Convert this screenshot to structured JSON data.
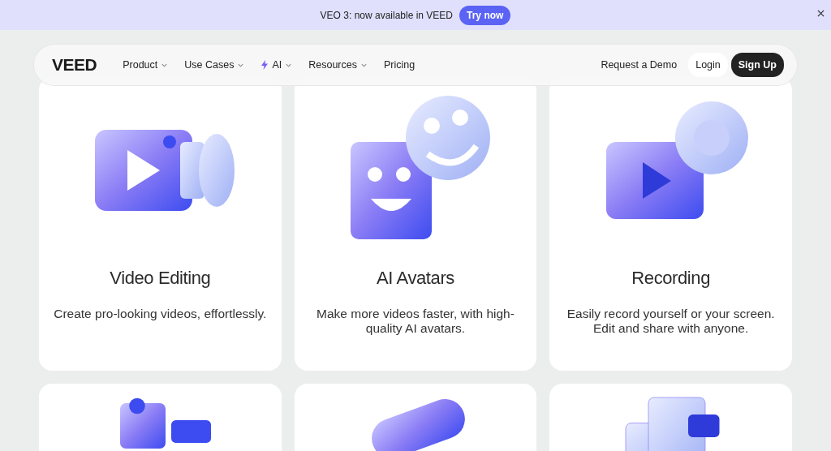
{
  "banner": {
    "text": "VEO 3: now available in VEED",
    "button": "Try now"
  },
  "nav": {
    "logo": "VEED",
    "items": [
      {
        "label": "Product",
        "kind": "dropdown"
      },
      {
        "label": "Use Cases",
        "kind": "dropdown"
      },
      {
        "label": "AI",
        "kind": "ai-dropdown"
      },
      {
        "label": "Resources",
        "kind": "dropdown"
      },
      {
        "label": "Pricing",
        "kind": "link"
      }
    ],
    "actions": [
      {
        "label": "Request a Demo",
        "kind": "link"
      },
      {
        "label": "Login",
        "kind": "light"
      },
      {
        "label": "Sign Up",
        "kind": "dark"
      }
    ]
  },
  "cards": [
    {
      "kind": "camera",
      "title": "Video Editing",
      "description": "Create pro-looking videos, effortlessly."
    },
    {
      "kind": "faces",
      "title": "AI Avatars",
      "description": "Make more videos faster, with high-quality AI avatars."
    },
    {
      "kind": "record",
      "title": "Recording",
      "description": "Easily record yourself or your screen. Edit and share with anyone."
    },
    {
      "kind": "pin"
    },
    {
      "kind": "tag"
    },
    {
      "kind": "windows"
    }
  ]
}
